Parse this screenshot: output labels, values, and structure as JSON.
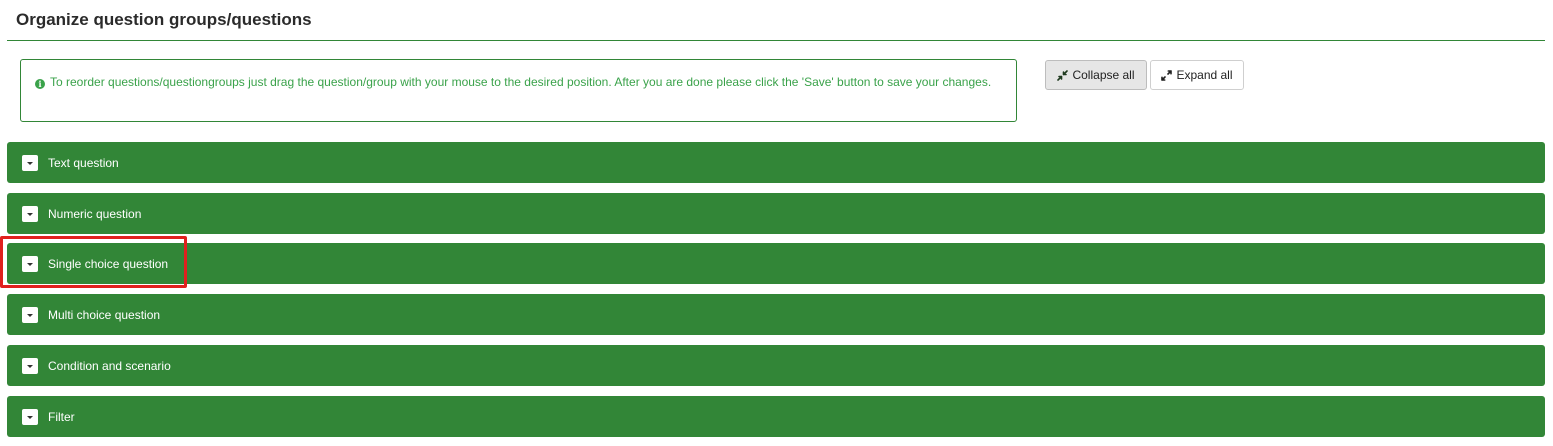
{
  "page": {
    "title": "Organize question groups/questions"
  },
  "info": {
    "icon": "info-circle-icon",
    "text": "To reorder questions/questiongroups just drag the question/group with your mouse to the desired position. After you are done please click the 'Save' button to save your changes."
  },
  "toolbar": {
    "collapse_label": "Collapse all",
    "expand_label": "Expand all"
  },
  "groups": [
    {
      "label": "Text question"
    },
    {
      "label": "Numeric question"
    },
    {
      "label": "Single choice question"
    },
    {
      "label": "Multi choice question"
    },
    {
      "label": "Condition and scenario"
    },
    {
      "label": "Filter"
    }
  ],
  "highlighted_group": "Single choice question",
  "colors": {
    "group_bg": "#328637",
    "info_text": "#3aa24a",
    "highlight": "#e0201e"
  }
}
